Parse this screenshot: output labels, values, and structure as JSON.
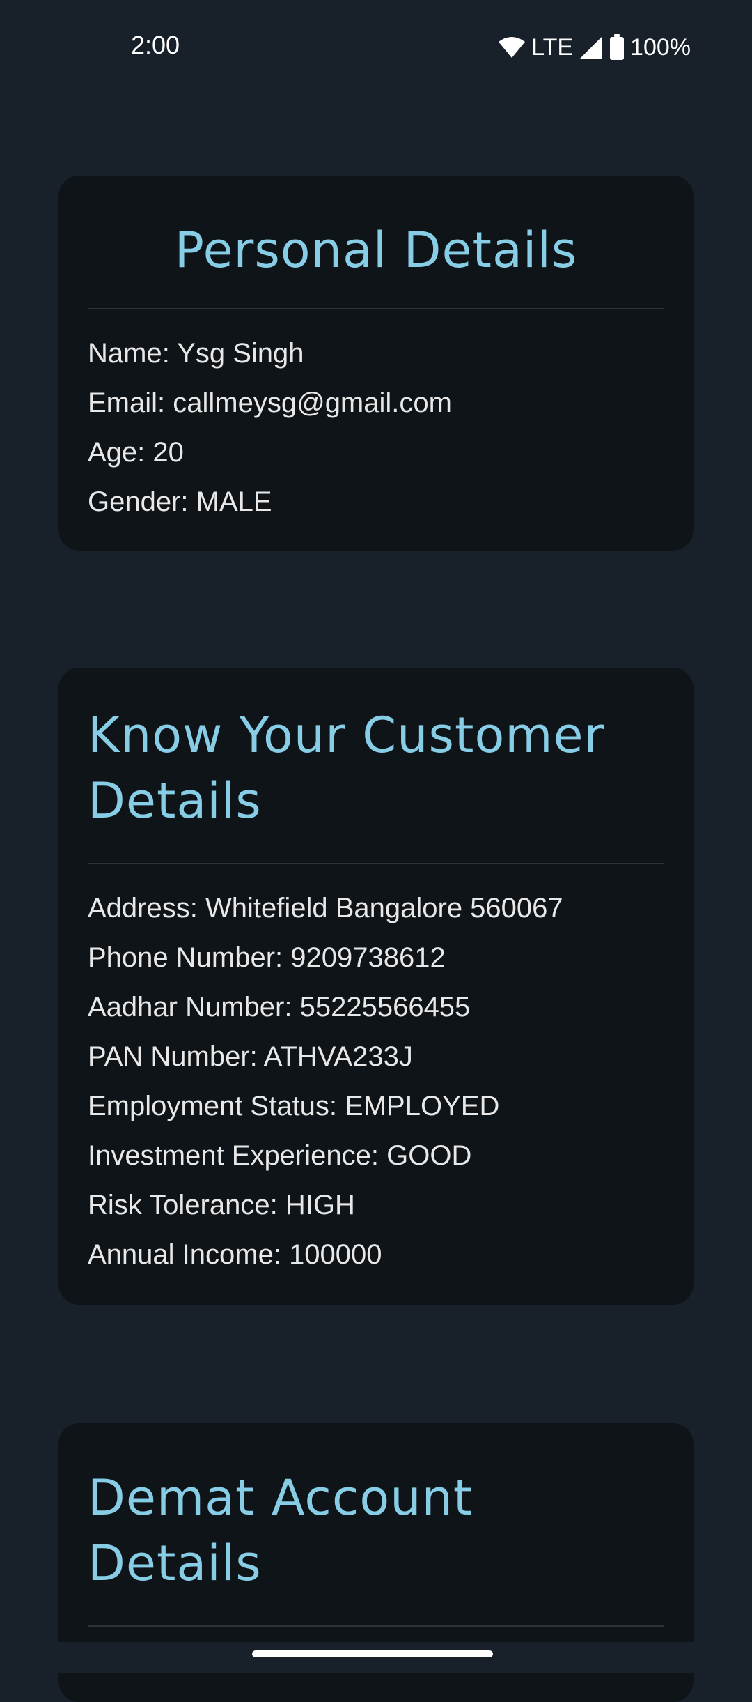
{
  "status_bar": {
    "time": "2:00",
    "network": "LTE",
    "battery": "100%",
    "icons": [
      "wifi-icon",
      "signal-icon",
      "battery-icon"
    ]
  },
  "personal": {
    "title": "Personal Details",
    "rows": [
      {
        "label": "Name: ",
        "value": "Ysg Singh"
      },
      {
        "label": "Email: ",
        "value": "callmeysg@gmail.com"
      },
      {
        "label": "Age: ",
        "value": "20"
      },
      {
        "label": "Gender: ",
        "value": "MALE"
      }
    ]
  },
  "kyc": {
    "title_line1": "Know Your Customer",
    "title_line2": "Details",
    "rows": [
      {
        "label": "Address: ",
        "value": "Whitefield Bangalore 560067"
      },
      {
        "label": "Phone Number: ",
        "value": "9209738612"
      },
      {
        "label": "Aadhar Number: ",
        "value": "55225566455"
      },
      {
        "label": "PAN Number: ",
        "value": "ATHVA233J"
      },
      {
        "label": "Employment Status: ",
        "value": "EMPLOYED"
      },
      {
        "label": "Investment Experience: ",
        "value": "GOOD"
      },
      {
        "label": "Risk Tolerance: ",
        "value": "HIGH"
      },
      {
        "label": "Annual Income: ",
        "value": "100000"
      }
    ]
  },
  "demat": {
    "title_line1": "Demat Account",
    "title_line2": "Details"
  },
  "colors": {
    "background": "#18202a",
    "card": "#0f1418",
    "accent": "#87cde6",
    "text": "#e8e8e8"
  }
}
